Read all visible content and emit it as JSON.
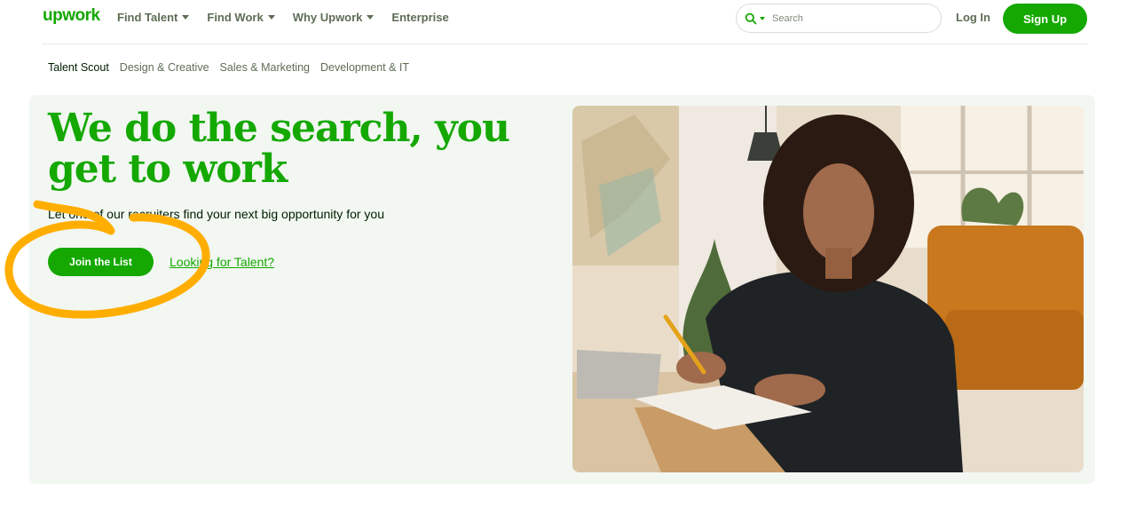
{
  "brand": {
    "logo_text": "upwork",
    "accent": "#14a800",
    "annotation_color": "#ffae00"
  },
  "nav": {
    "links": [
      {
        "label": "Find Talent",
        "has_caret": true
      },
      {
        "label": "Find Work",
        "has_caret": true
      },
      {
        "label": "Why Upwork",
        "has_caret": true
      },
      {
        "label": "Enterprise",
        "has_caret": false
      }
    ],
    "search": {
      "placeholder": "Search",
      "icon": "search-icon"
    },
    "login_label": "Log In",
    "signup_label": "Sign Up"
  },
  "subnav": {
    "items": [
      "Talent Scout",
      "Design & Creative",
      "Sales & Marketing",
      "Development & IT"
    ],
    "active": "Talent Scout"
  },
  "hero": {
    "title": "We do the search, you get to work",
    "subtitle": "Let one of our recruiters find your next big opportunity for you",
    "primary_cta": "Join the List",
    "secondary_link": "Looking for Talent?"
  },
  "photo": {
    "description_icon": "woman-writing-photo"
  }
}
